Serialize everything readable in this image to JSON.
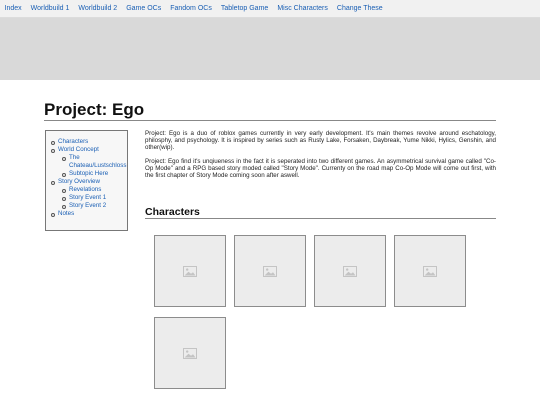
{
  "nav": {
    "items": [
      "Index",
      "Worldbuild 1",
      "Worldbuild 2",
      "Game OCs",
      "Fandom OCs",
      "Tabletop Game",
      "Misc Characters",
      "Change These"
    ]
  },
  "page": {
    "title": "Project: Ego"
  },
  "toc": {
    "items": [
      {
        "label": "Characters",
        "children": []
      },
      {
        "label": "World Concept",
        "children": [
          "The\nChateau/Lustschloss",
          "Subtopic Here"
        ]
      },
      {
        "label": "Story Overview",
        "children": [
          "Revelations",
          "Story Event 1",
          "Story Event 2"
        ]
      },
      {
        "label": "Notes",
        "children": []
      }
    ]
  },
  "intro": {
    "paragraphs": [
      "Project: Ego is a duo of roblox games currently in very early development. It's main themes revolve around eschatology, philosphy, and psychology. It is inspired by series such as Rusty Lake, Forsaken, Daybreak, Yume Nikki, Hylics, Genshin, and other(wip).",
      "Project: Ego find it's unqiueness in the fact it is seperated into two different games. An asymmetrical survival game called \"Co-Op Mode\" and a RPG based story moded called \"Story Mode\". Currenty on the road map Co-Op Mode will come out first, with the first chapter of Story Mode coming soon after aswell."
    ]
  },
  "characters": {
    "heading": "Characters",
    "card_icon": "image-placeholder-icon",
    "card_count": 5
  },
  "colors": {
    "link": "#1a5fb4",
    "banner": "#d9d9d9",
    "nav_bg": "#f1f1f1",
    "card_bg": "#ececec"
  }
}
